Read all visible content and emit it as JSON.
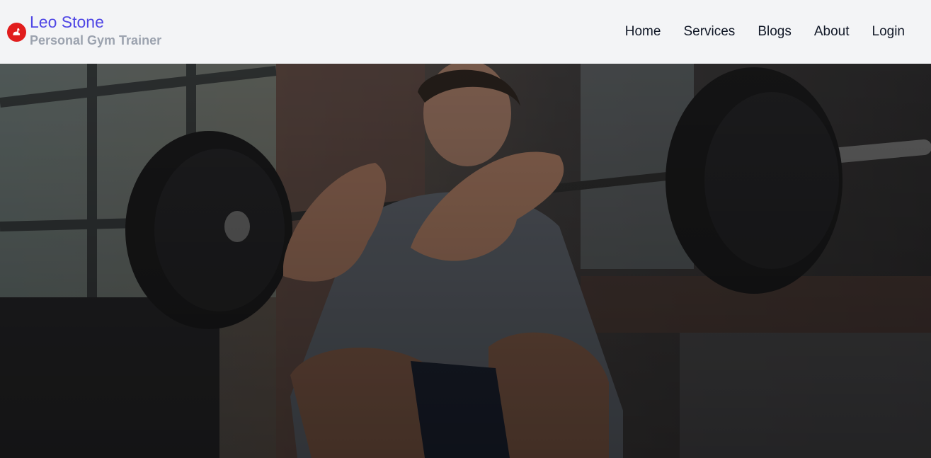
{
  "brand": {
    "name": "Leo Stone",
    "tagline": "Personal Gym Trainer",
    "logo_icon": "flexed-arm-icon",
    "logo_color": "#e11d1d",
    "name_color": "#4f46e5"
  },
  "nav": {
    "items": [
      {
        "label": "Home"
      },
      {
        "label": "Services"
      },
      {
        "label": "Blogs"
      },
      {
        "label": "About"
      },
      {
        "label": "Login"
      }
    ]
  },
  "hero": {
    "image": "man-front-squat-barbell-photo"
  }
}
